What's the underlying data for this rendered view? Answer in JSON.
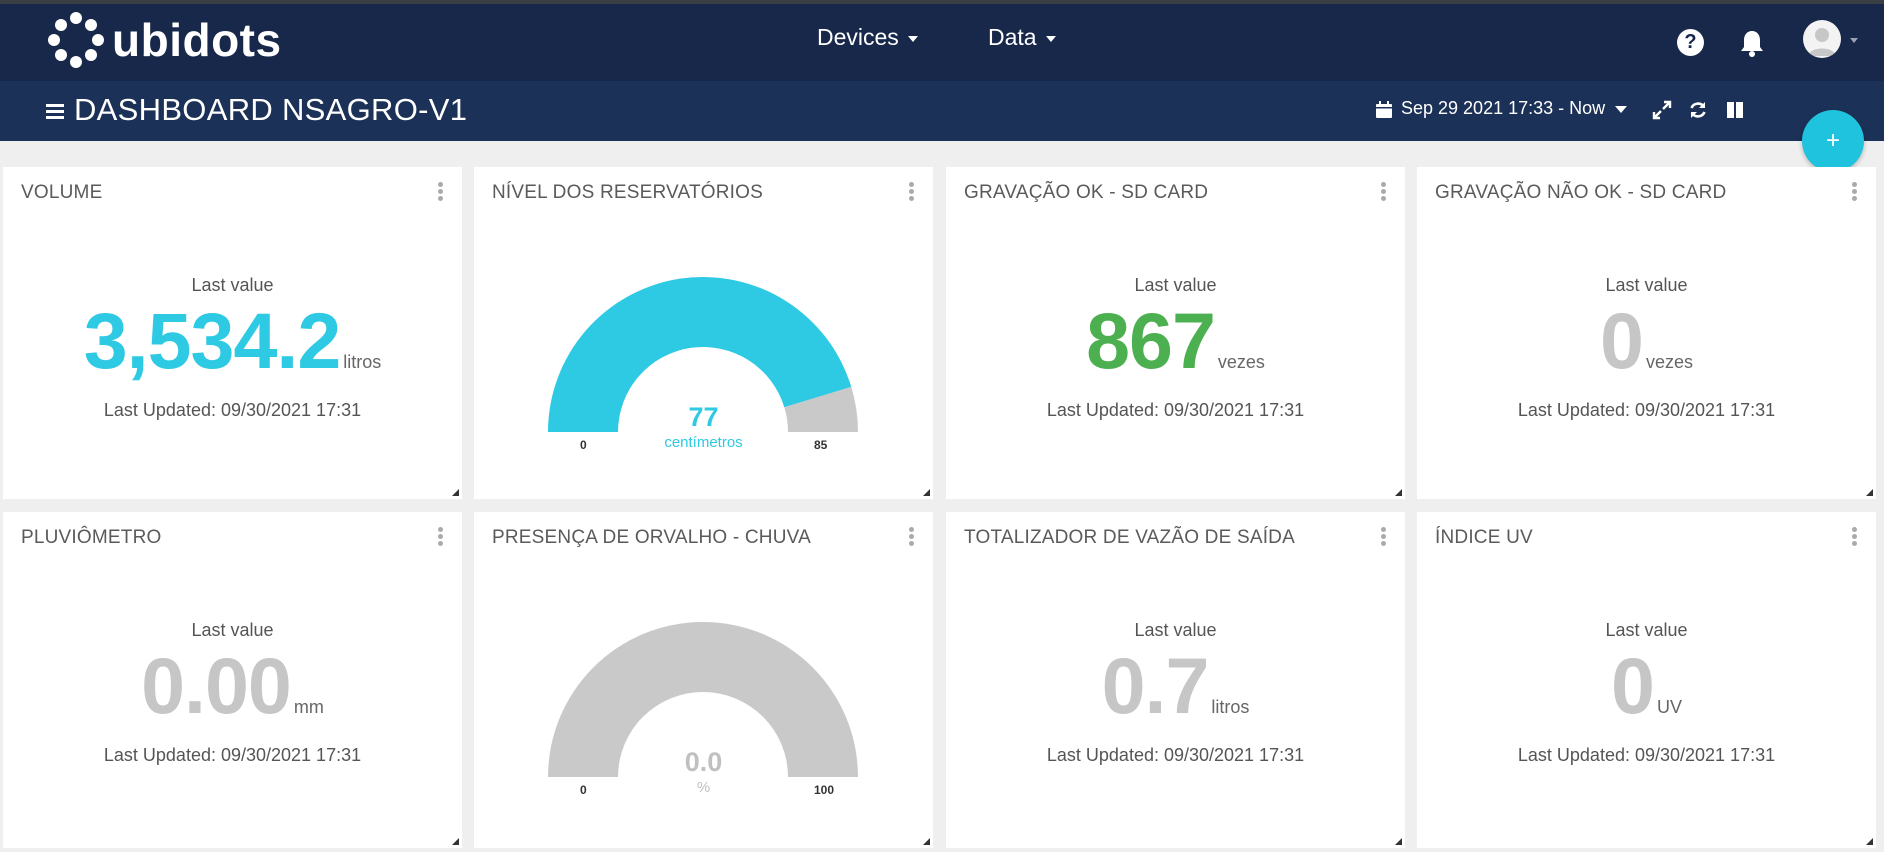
{
  "app": {
    "brand": "ubidots",
    "nav": [
      {
        "label": "Devices"
      },
      {
        "label": "Data"
      }
    ]
  },
  "dashboard": {
    "title": "DASHBOARD NSAGRO-V1",
    "date_range": "Sep 29 2021 17:33 - Now"
  },
  "colors": {
    "navbar": "#17284a",
    "subbar": "#1c3157",
    "accent": "#2ec9e3",
    "green": "#4caf50",
    "gray": "#c6c6c6"
  },
  "widgets": [
    {
      "title": "VOLUME",
      "caption": "Last value",
      "value": "3,534.2",
      "unit": "litros",
      "updated": "Last Updated: 09/30/2021 17:31",
      "color": "#2ec9e3"
    },
    {
      "title": "NÍVEL DOS RESERVATÓRIOS",
      "type": "gauge",
      "value": "77",
      "unit": "centímetros",
      "min": "0",
      "max": "85",
      "fill_fraction": 0.906,
      "color": "#2ec9e3"
    },
    {
      "title": "GRAVAÇÃO OK - SD CARD",
      "caption": "Last value",
      "value": "867",
      "unit": "vezes",
      "updated": "Last Updated: 09/30/2021 17:31",
      "color": "#4caf50"
    },
    {
      "title": "GRAVAÇÃO NÃO OK - SD CARD",
      "caption": "Last value",
      "value": "0",
      "unit": "vezes",
      "updated": "Last Updated: 09/30/2021 17:31",
      "color": "#c6c6c6"
    },
    {
      "title": "PLUVIÔMETRO",
      "caption": "Last value",
      "value": "0.00",
      "unit": "mm",
      "updated": "Last Updated: 09/30/2021 17:31",
      "color": "#c6c6c6"
    },
    {
      "title": "PRESENÇA DE ORVALHO - CHUVA",
      "type": "gauge",
      "value": "0.0",
      "unit": "%",
      "min": "0",
      "max": "100",
      "fill_fraction": 0.0,
      "color": "#c6c6c6"
    },
    {
      "title": "TOTALIZADOR DE VAZÃO DE SAÍDA",
      "caption": "Last value",
      "value": "0.7",
      "unit": "litros",
      "updated": "Last Updated: 09/30/2021 17:31",
      "color": "#c6c6c6"
    },
    {
      "title": "ÍNDICE UV",
      "caption": "Last value",
      "value": "0",
      "unit": "UV",
      "updated": "Last Updated: 09/30/2021 17:31",
      "color": "#c6c6c6"
    }
  ]
}
